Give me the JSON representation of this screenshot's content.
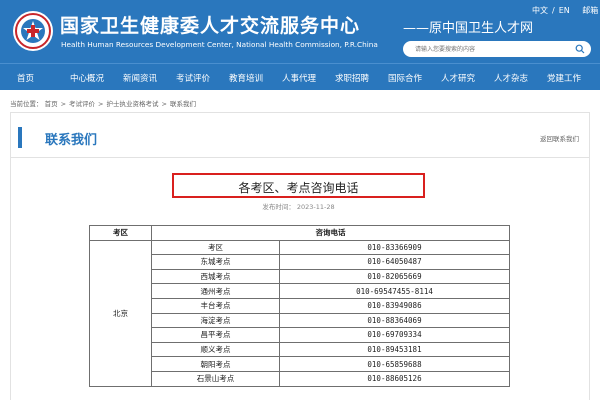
{
  "header": {
    "title": "国家卫生健康委人才交流服务中心",
    "subtitle": "Health Human Resources Development Center, National Health Commission, P.R.China",
    "slogan": "——原中国卫生人才网",
    "lang_zh": "中文",
    "lang_sep": "/",
    "lang_en": "EN",
    "mailbox": "邮箱",
    "search_placeholder": "请输入您要搜索的内容"
  },
  "nav": {
    "items": [
      "首页",
      "中心概况",
      "新闻资讯",
      "考试评价",
      "教育培训",
      "人事代理",
      "求职招聘",
      "国际合作",
      "人才研究",
      "人才杂志",
      "党建工作"
    ]
  },
  "breadcrumb": {
    "label": "当前位置：",
    "items": [
      "首页",
      "考试评价",
      "护士执业资格考试",
      "联系我们"
    ],
    "separator": ">"
  },
  "panel": {
    "title": "联系我们",
    "back_link": "返回联系我们"
  },
  "article": {
    "title": "各考区、考点咨询电话",
    "date_label": "发布时间：",
    "date": "2023-11-28"
  },
  "table": {
    "headers": [
      "考区",
      "咨询电话"
    ],
    "region": "北京",
    "rows": [
      {
        "site": "考区",
        "phone": "010-83366909"
      },
      {
        "site": "东城考点",
        "phone": "010-64050487"
      },
      {
        "site": "西城考点",
        "phone": "010-82065669"
      },
      {
        "site": "通州考点",
        "phone": "010-69547455-8114"
      },
      {
        "site": "丰台考点",
        "phone": "010-83949086"
      },
      {
        "site": "海淀考点",
        "phone": "010-88364069"
      },
      {
        "site": "昌平考点",
        "phone": "010-69709334"
      },
      {
        "site": "顺义考点",
        "phone": "010-89453181"
      },
      {
        "site": "朝阳考点",
        "phone": "010-65859688"
      },
      {
        "site": "石景山考点",
        "phone": "010-88605126"
      }
    ]
  },
  "colors": {
    "brand_blue": "#2a77bd",
    "highlight_red": "#d9201e"
  }
}
